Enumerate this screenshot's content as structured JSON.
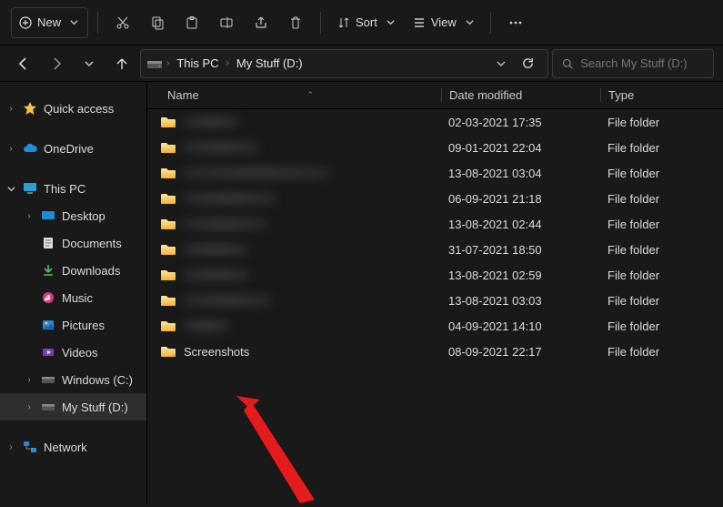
{
  "toolbar": {
    "new_label": "New",
    "sort_label": "Sort",
    "view_label": "View"
  },
  "breadcrumb": {
    "root": "This PC",
    "current": "My Stuff (D:)"
  },
  "search": {
    "placeholder": "Search My Stuff (D:)"
  },
  "sidebar": {
    "quick_access": "Quick access",
    "onedrive": "OneDrive",
    "this_pc": "This PC",
    "desktop": "Desktop",
    "documents": "Documents",
    "downloads": "Downloads",
    "music": "Music",
    "pictures": "Pictures",
    "videos": "Videos",
    "windows_c": "Windows (C:)",
    "my_stuff_d": "My Stuff (D:)",
    "network": "Network"
  },
  "columns": {
    "name": "Name",
    "date": "Date modified",
    "type": "Type"
  },
  "rows": [
    {
      "name": "",
      "blurred": true,
      "wclass": "w1",
      "date": "02-03-2021 17:35",
      "type": "File folder"
    },
    {
      "name": "",
      "blurred": true,
      "wclass": "w2",
      "date": "09-01-2021 22:04",
      "type": "File folder"
    },
    {
      "name": "",
      "blurred": true,
      "wclass": "w3",
      "date": "13-08-2021 03:04",
      "type": "File folder"
    },
    {
      "name": "",
      "blurred": true,
      "wclass": "w4",
      "date": "06-09-2021 21:18",
      "type": "File folder"
    },
    {
      "name": "",
      "blurred": true,
      "wclass": "w5",
      "date": "13-08-2021 02:44",
      "type": "File folder"
    },
    {
      "name": "",
      "blurred": true,
      "wclass": "w6",
      "date": "31-07-2021 18:50",
      "type": "File folder"
    },
    {
      "name": "",
      "blurred": true,
      "wclass": "w7",
      "date": "13-08-2021 02:59",
      "type": "File folder"
    },
    {
      "name": "",
      "blurred": true,
      "wclass": "w8",
      "date": "13-08-2021 03:03",
      "type": "File folder"
    },
    {
      "name": "",
      "blurred": true,
      "wclass": "w9",
      "date": "04-09-2021 14:10",
      "type": "File folder"
    },
    {
      "name": "Screenshots",
      "blurred": false,
      "date": "08-09-2021 22:17",
      "type": "File folder"
    }
  ]
}
